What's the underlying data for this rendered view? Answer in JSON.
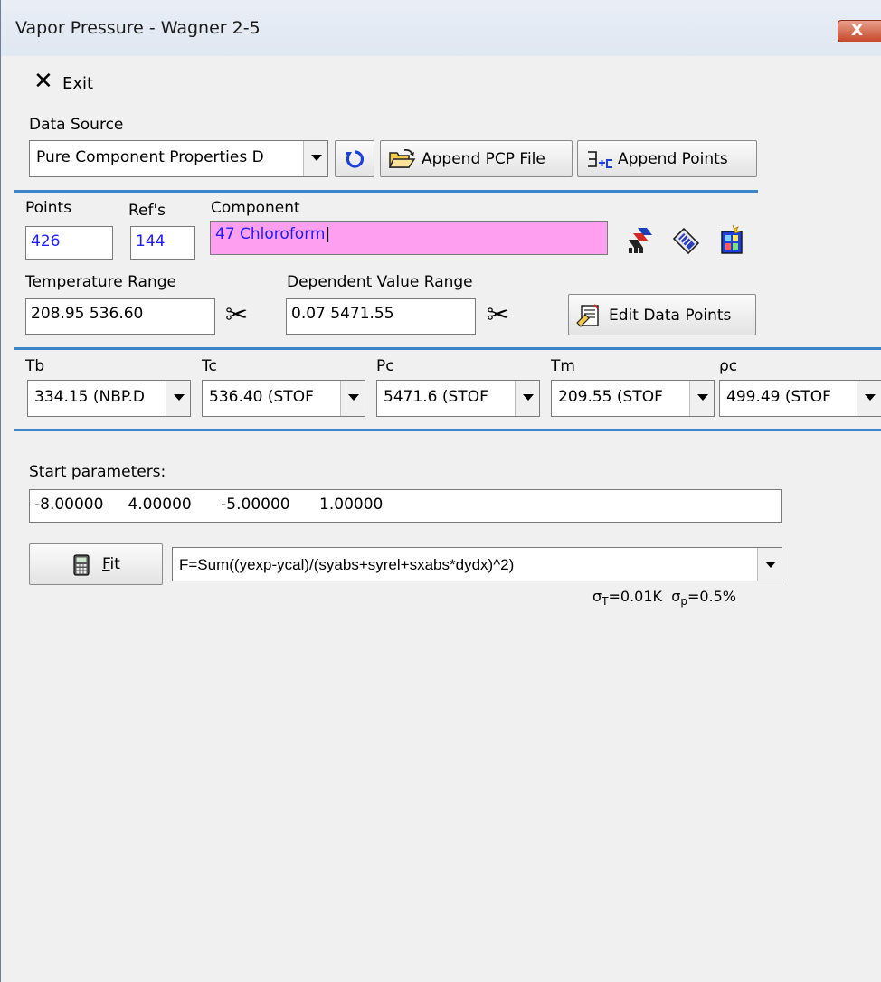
{
  "window": {
    "title": "Vapor Pressure - Wagner 2-5",
    "close_glyph": "X"
  },
  "menu": {
    "exit_prefix": "E",
    "exit_underlined": "x",
    "exit_suffix": "it"
  },
  "data_source": {
    "label": "Data Source",
    "selected": "Pure Component Properties D",
    "append_pcp_label": "Append PCP File",
    "append_points_label": "Append Points"
  },
  "summary": {
    "points_label": "Points",
    "points_value": "426",
    "refs_label": "Ref's",
    "refs_value": "144",
    "component_label": "Component",
    "component_value": "47 Chloroform"
  },
  "ranges": {
    "temperature_label": "Temperature Range",
    "temperature_value": "208.95 536.60",
    "dependent_label": "Dependent Value Range",
    "dependent_value": "0.07  5471.55",
    "edit_points_label": "Edit Data Points"
  },
  "constants": [
    {
      "label": "Tb",
      "value": "334.15 (NBP.D"
    },
    {
      "label": "Tc",
      "value": "536.40 (STOF"
    },
    {
      "label": "Pc",
      "value": "5471.6 (STOF"
    },
    {
      "label": "Tm",
      "value": "209.55 (STOF"
    },
    {
      "label": "ρc",
      "value": "499.49 (STOF"
    }
  ],
  "fit": {
    "start_label": "Start parameters:",
    "start_value": "-8.00000     4.00000      -5.00000      1.00000",
    "fit_prefix": "",
    "fit_underlined": "F",
    "fit_suffix": "it",
    "objective": "F=Sum((yexp-ycal)/(syabs+syrel+sxabs*dydx)^2)",
    "sigma_t_symbol": "σ",
    "sigma_t_sub": "T",
    "sigma_t_value": "=0.01K",
    "sigma_p_symbol": "σ",
    "sigma_p_sub": "p",
    "sigma_p_value": "=0.5%"
  },
  "colors": {
    "component_highlight": "#ff9fef",
    "section_line": "#3a86c8",
    "value_text": "#1c1cff"
  },
  "icons": [
    "exit-icon",
    "refresh-icon",
    "open-folder-icon",
    "append-points-icon",
    "copy-component-icon",
    "component-list-icon",
    "new-component-icon",
    "scissors-icon",
    "edit-data-icon",
    "calculator-icon"
  ]
}
